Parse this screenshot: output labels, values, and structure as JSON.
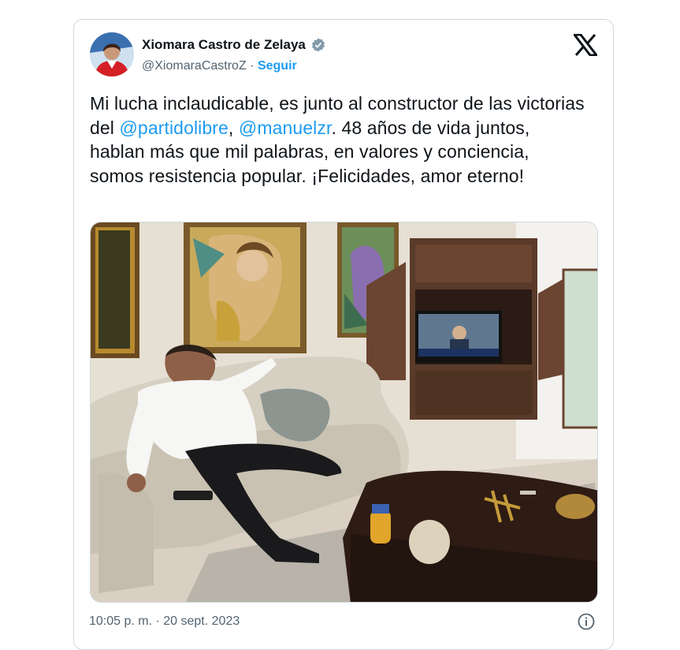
{
  "author": {
    "display_name": "Xiomara Castro de Zelaya",
    "handle": "@XiomaraCastroZ",
    "separator": "·",
    "follow_label": "Seguir"
  },
  "tweet": {
    "text_part1": "Mi lucha inclaudicable, es junto al constructor de las victorias del ",
    "mention1": "@partidolibre",
    "text_part2": ", ",
    "mention2": "@manuelzr",
    "text_part3": ". 48 años de vida juntos, hablan más que mil palabras, en valores y conciencia, somos resistencia popular. ¡Felicidades, amor eterno!"
  },
  "footer": {
    "timestamp": "10:05 p. m. · 20 sept. 2023"
  },
  "icons": {
    "verified": "verified-badge-icon",
    "brand": "x-logo-icon",
    "info": "info-icon"
  },
  "colors": {
    "accent": "#1d9bf0",
    "text": "#0f1419",
    "secondary": "#536471",
    "border": "#cfd9de"
  }
}
